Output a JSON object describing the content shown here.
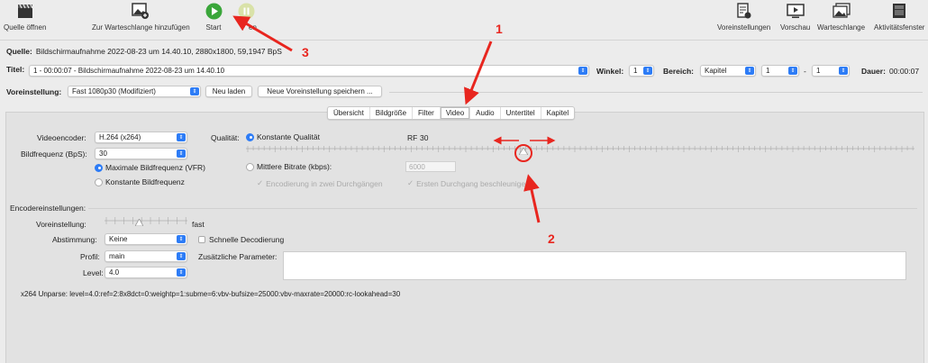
{
  "toolbar": {
    "open_source": "Quelle öffnen",
    "add_queue": "Zur Warteschlange hinzufügen",
    "start": "Start",
    "pause_partial": "en",
    "presets": "Voreinstellungen",
    "preview": "Vorschau",
    "queue": "Warteschlange",
    "activity": "Aktivitätsfenster"
  },
  "source": {
    "label": "Quelle:",
    "value": "Bildschirmaufnahme 2022-08-23 um 14.40.10, 2880x1800, 59,1947 BpS"
  },
  "title_row": {
    "label": "Titel:",
    "value": "1 - 00:00:07 - Bildschirmaufnahme 2022-08-23 um 14.40.10",
    "angle_label": "Winkel:",
    "angle_value": "1",
    "range_label": "Bereich:",
    "range_type": "Kapitel",
    "range_from": "1",
    "range_dash": "-",
    "range_to": "1",
    "duration_label": "Dauer:",
    "duration_value": "00:00:07"
  },
  "preset_row": {
    "label": "Voreinstellung:",
    "value": "Fast 1080p30 (Modifiziert)",
    "reload": "Neu laden",
    "save_new": "Neue Voreinstellung speichern ..."
  },
  "tabs": [
    "Übersicht",
    "Bildgröße",
    "Filter",
    "Video",
    "Audio",
    "Untertitel",
    "Kapitel"
  ],
  "active_tab": "Video",
  "video": {
    "encoder_label": "Videoencoder:",
    "encoder_value": "H.264 (x264)",
    "framerate_label": "Bildfrequenz (BpS):",
    "framerate_value": "30",
    "vfr_label": "Maximale Bildfrequenz (VFR)",
    "cfr_label": "Konstante Bildfrequenz",
    "quality_label": "Qualität:",
    "constant_quality": "Konstante Qualität",
    "rf_label": "RF",
    "rf_value": "30",
    "avg_bitrate": "Mittlere Bitrate (kbps):",
    "bitrate_value": "6000",
    "two_pass": "Encodierung in zwei Durchgängen",
    "turbo": "Ersten Durchgang beschleunigen"
  },
  "encoder_settings": {
    "title": "Encodereinstellungen:",
    "preset_label": "Voreinstellung:",
    "preset_value": "fast",
    "tune_label": "Abstimmung:",
    "tune_value": "Keine",
    "fast_decode": "Schnelle Decodierung",
    "profile_label": "Profil:",
    "profile_value": "main",
    "extra_params": "Zusätzliche Parameter:",
    "level_label": "Level:",
    "level_value": "4.0",
    "unparse": "x264 Unparse: level=4.0:ref=2:8x8dct=0:weightp=1:subme=6:vbv-bufsize=25000:vbv-maxrate=20000:rc-lookahead=30"
  },
  "annotations": [
    "1",
    "2",
    "3"
  ],
  "colors": {
    "accent": "#2d7cf6",
    "annotation": "#e8261f",
    "play": "#3aa63a"
  }
}
